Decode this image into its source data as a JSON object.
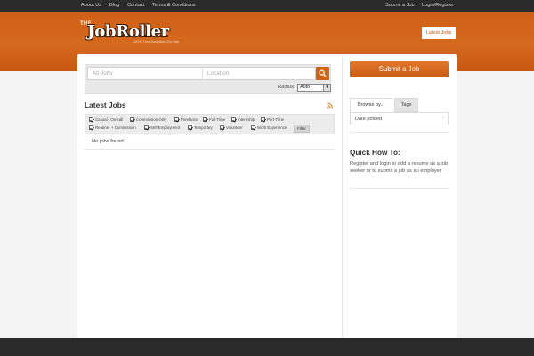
{
  "topnav": {
    "left": [
      "About Us",
      "Blog",
      "Contact",
      "Terms & Conditions"
    ],
    "right": [
      "Submit a Job",
      "Login/Register"
    ]
  },
  "header": {
    "logo_the": "THE",
    "logo_name": "JobRoller",
    "logo_tagline": "100% Free Australian Job Site",
    "latest_jobs_button": "Latest Jobs"
  },
  "search": {
    "keywords_placeholder": "All Jobs",
    "location_placeholder": "Location",
    "radius_label": "Radius:",
    "radius_value": "Auto"
  },
  "jobs": {
    "title": "Latest Jobs",
    "filters": [
      "Casual / On-call",
      "Commission Only",
      "Freelance",
      "Full-Time",
      "Internship",
      "Part-Time",
      "Retainer + Commission",
      "Self Employment",
      "Temporary",
      "Volunteer",
      "Work Experience"
    ],
    "filter_button": "Filter",
    "empty_message": "No jobs found."
  },
  "sidebar": {
    "submit_button": "Submit a Job",
    "tabs": [
      "Browse by...",
      "Tags"
    ],
    "browse_items": [
      "Date posted"
    ],
    "howto_title": "Quick How To:",
    "howto_text": "Register and login to add a resume as a job seeker or to submit a job as an employer"
  },
  "colors": {
    "accent": "#d06417",
    "topbar": "#2a2a2a"
  }
}
